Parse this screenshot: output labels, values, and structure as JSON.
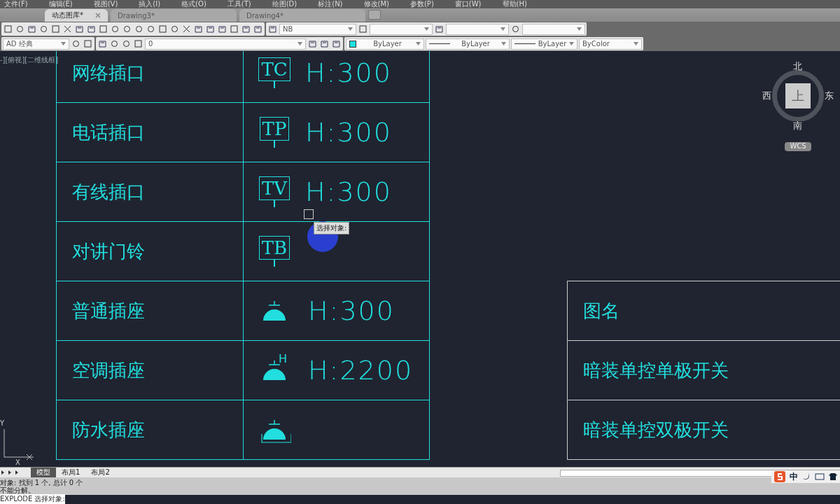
{
  "menu": [
    "文件(F)",
    "编辑(E)",
    "视图(V)",
    "插入(I)",
    "格式(O)",
    "工具(T)",
    "绘图(D)",
    "标注(N)",
    "修改(M)",
    "参数(P)",
    "窗口(W)",
    "帮助(H)"
  ],
  "file_tabs": [
    {
      "label": "动态图库*",
      "selected": true
    },
    {
      "label": "Drawing3*",
      "selected": false
    },
    {
      "label": "Drawing4*",
      "selected": false
    }
  ],
  "toolbar": {
    "text_style": "NB",
    "workspace": "AD 经典",
    "layer": "0",
    "color_setting": "ByLayer",
    "linetype": "ByLayer",
    "lineweight": "ByLayer",
    "plot_style": "ByColor"
  },
  "viewport_label": "-][俯视][二维线框]",
  "legend_rows": [
    {
      "label": "网络插口",
      "symbol": {
        "kind": "box",
        "text": "TC"
      },
      "height": "H:300"
    },
    {
      "label": "电话插口",
      "symbol": {
        "kind": "box",
        "text": "TP"
      },
      "height": "H:300"
    },
    {
      "label": "有线插口",
      "symbol": {
        "kind": "box",
        "text": "TV"
      },
      "height": "H:300"
    },
    {
      "label": "对讲门铃",
      "symbol": {
        "kind": "box",
        "text": "TB"
      }
    },
    {
      "label": "普通插座",
      "symbol": {
        "kind": "socket"
      },
      "height": "H:300"
    },
    {
      "label": "空调插座",
      "symbol": {
        "kind": "socket",
        "text": "H"
      },
      "height": "H:2200"
    },
    {
      "label": "防水插座",
      "symbol": {
        "kind": "waterproof"
      }
    }
  ],
  "title_rows": [
    "图名",
    "暗装单控单极开关",
    "暗装单控双极开关"
  ],
  "tooltip": "选择对象:",
  "viewcube": {
    "north": "北",
    "south": "南",
    "west": "西",
    "east": "东",
    "top": "上",
    "ucs": "WCS"
  },
  "ucs_axes": {
    "y": "Y",
    "x": "X"
  },
  "layout_tabs": [
    {
      "label": "模型",
      "selected": true
    },
    {
      "label": "布局1",
      "selected": false
    },
    {
      "label": "布局2",
      "selected": false
    }
  ],
  "command_lines": [
    "对象: 找到 1 个, 总计 0 个",
    "不能分解。",
    "EXPLODE 选择对象:"
  ],
  "ime": {
    "mode": "中"
  }
}
